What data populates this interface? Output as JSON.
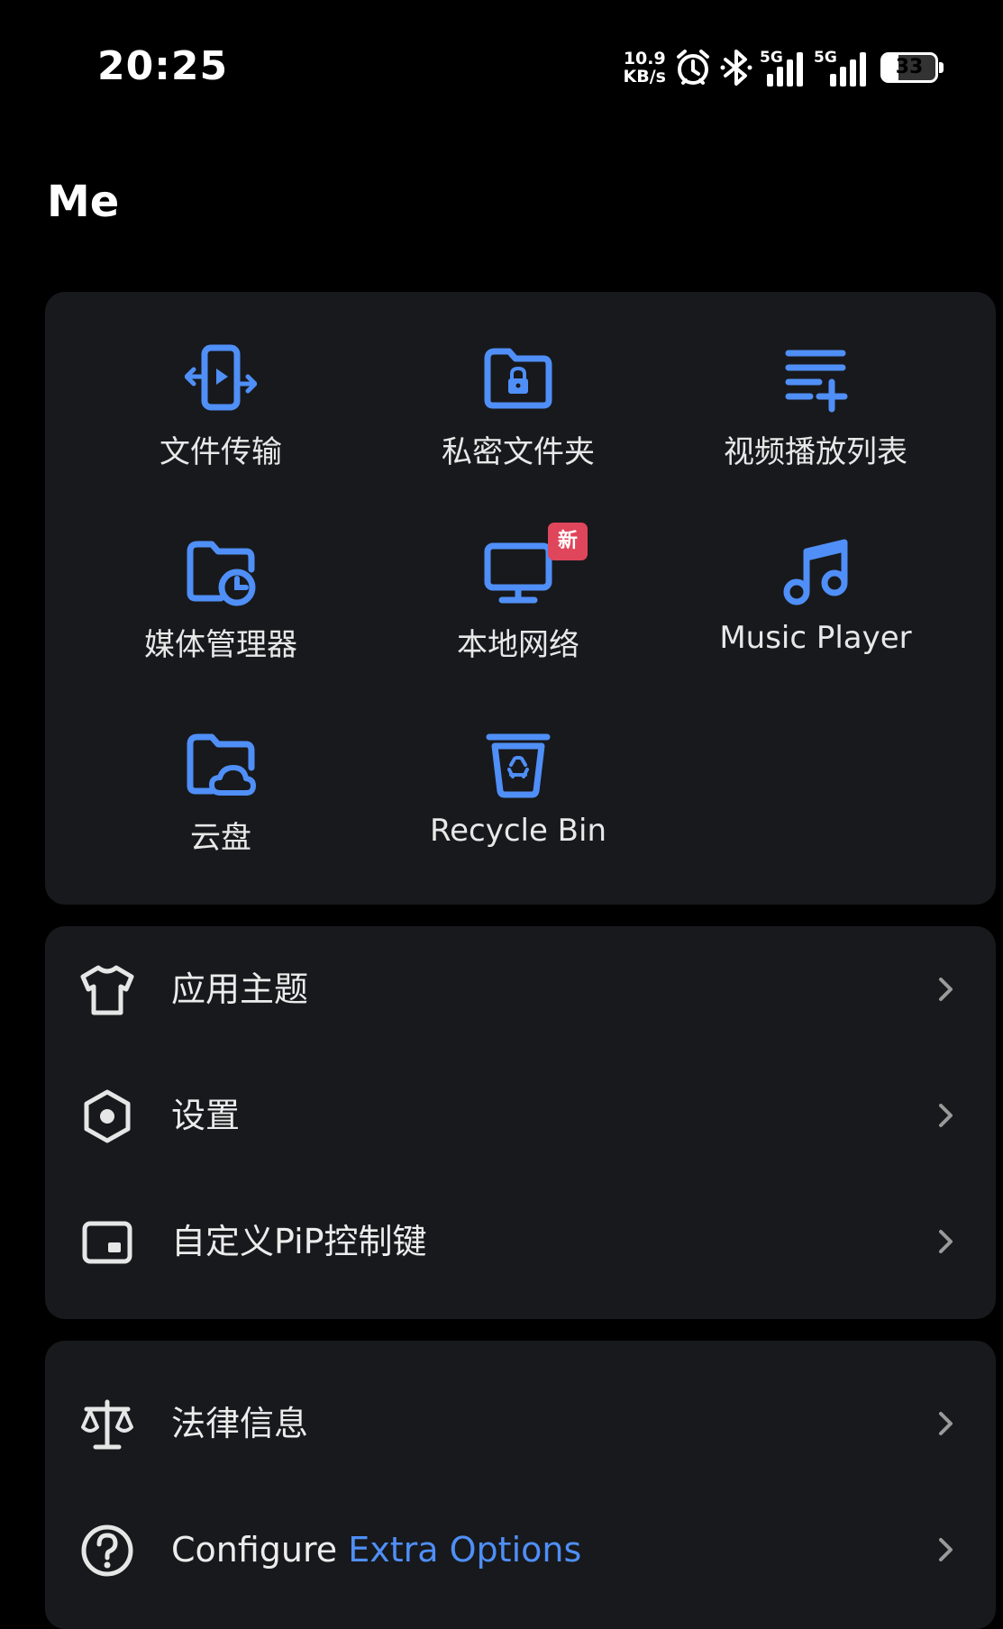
{
  "status_bar": {
    "time": "20:25",
    "net_speed_value": "10.9",
    "net_speed_unit": "KB/s",
    "signal_1_label": "5G",
    "signal_2_label": "5G",
    "battery_level": "33",
    "icons": [
      "alarm-icon",
      "bluetooth-icon",
      "signal-icon",
      "battery-icon"
    ]
  },
  "page": {
    "title": "Me"
  },
  "grid": {
    "items": [
      {
        "label": "文件传输",
        "icon": "file-transfer-icon"
      },
      {
        "label": "私密文件夹",
        "icon": "private-folder-icon"
      },
      {
        "label": "视频播放列表",
        "icon": "video-playlist-icon"
      },
      {
        "label": "媒体管理器",
        "icon": "media-manager-icon"
      },
      {
        "label": "本地网络",
        "icon": "local-network-icon",
        "badge": "新"
      },
      {
        "label": "Music Player",
        "icon": "music-note-icon"
      },
      {
        "label": "云盘",
        "icon": "cloud-folder-icon"
      },
      {
        "label": "Recycle Bin",
        "icon": "recycle-bin-icon"
      }
    ]
  },
  "settings_list": {
    "items": [
      {
        "label": "应用主题",
        "icon": "tshirt-icon"
      },
      {
        "label": "设置",
        "icon": "hexagon-settings-icon"
      },
      {
        "label": "自定义PiP控制键",
        "icon": "pip-icon"
      }
    ]
  },
  "info_list": {
    "items": [
      {
        "label": "法律信息",
        "icon": "scales-icon"
      },
      {
        "label_prefix": "Configure ",
        "label_accent": "Extra Options",
        "icon": "help-circle-icon"
      }
    ]
  },
  "colors": {
    "background": "#000000",
    "card": "#18191c",
    "accent": "#4f8ff7",
    "badge": "#e0465b",
    "text": "#ececec"
  }
}
